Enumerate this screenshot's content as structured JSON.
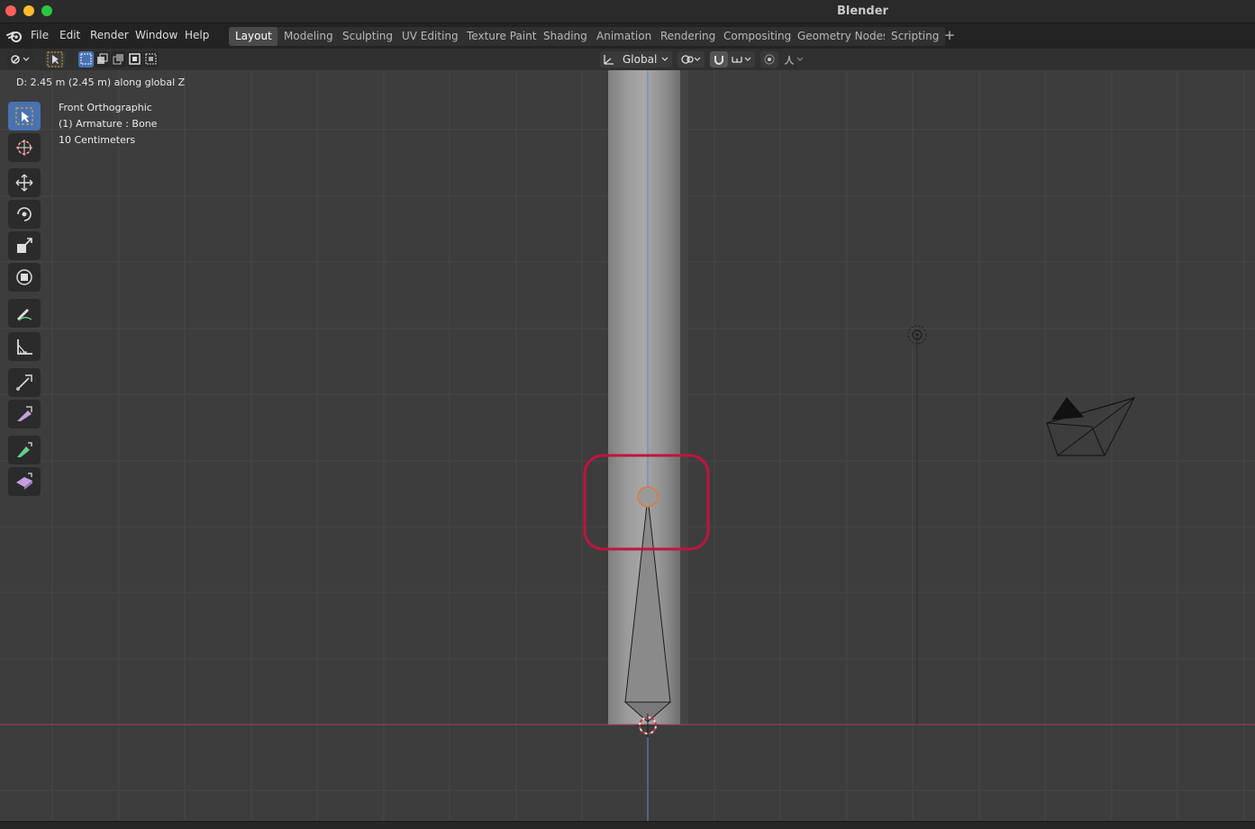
{
  "window": {
    "title": "Blender"
  },
  "menu": [
    "File",
    "Edit",
    "Render",
    "Window",
    "Help"
  ],
  "workspaces": [
    {
      "label": "Layout",
      "active": true
    },
    {
      "label": "Modeling",
      "active": false
    },
    {
      "label": "Sculpting",
      "active": false
    },
    {
      "label": "UV Editing",
      "active": false
    },
    {
      "label": "Texture Paint",
      "active": false
    },
    {
      "label": "Shading",
      "active": false
    },
    {
      "label": "Animation",
      "active": false
    },
    {
      "label": "Rendering",
      "active": false
    },
    {
      "label": "Compositing",
      "active": false
    },
    {
      "label": "Geometry Nodes",
      "active": false
    },
    {
      "label": "Scripting",
      "active": false
    }
  ],
  "header": {
    "transform_orientation": "Global"
  },
  "viewport": {
    "status": "D: 2.45 m (2.45 m) along global Z",
    "view_name": "Front Orthographic",
    "object_info": "(1) Armature : Bone",
    "grid_scale": "10 Centimeters"
  },
  "colors": {
    "accent_blue": "#4772b3",
    "highlight_red": "#c0143c",
    "x_axis": "#b53a4a",
    "z_axis": "#5a8ad6"
  },
  "tools": [
    "select-box-icon",
    "cursor-icon",
    "move-icon",
    "rotate-icon",
    "scale-icon",
    "transform-icon",
    "annotate-icon",
    "measure-icon",
    "extrude-icon",
    "extrude-to-cursor-icon",
    "bone-size-icon",
    "roll-icon"
  ]
}
